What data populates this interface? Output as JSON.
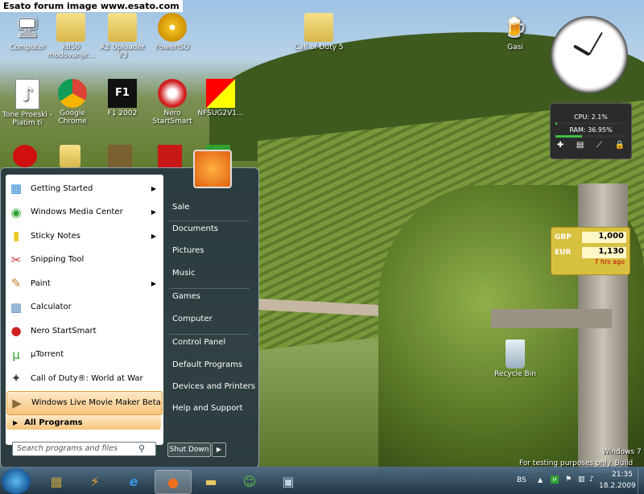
{
  "watermark": "Esato forum image www.esato.com",
  "desktop_icons": [
    {
      "label": "Computer",
      "icon": "computer-icon"
    },
    {
      "label": "k850 modovanje...",
      "icon": "folder-icon"
    },
    {
      "label": "A2 Uploader V3",
      "icon": "folder-icon"
    },
    {
      "label": "PowerISO",
      "icon": "disc-icon"
    },
    {
      "label": "Call of Duty 5",
      "icon": "folder-icon"
    },
    {
      "label": "Gasi",
      "icon": "beer-icon"
    },
    {
      "label": "Tone Proeski - Platim ti",
      "icon": "document-icon"
    },
    {
      "label": "Google Chrome",
      "icon": "chrome-icon"
    },
    {
      "label": "F1 2002",
      "icon": "f1-icon"
    },
    {
      "label": "Nero StartSmart",
      "icon": "nero-icon"
    },
    {
      "label": "NFSUG2V1...",
      "icon": "nfs-icon"
    },
    {
      "label": "Recycle Bin",
      "icon": "recycle-bin-icon"
    }
  ],
  "cpu_gadget": {
    "cpu": "CPU: 2.1%",
    "ram": "RAM: 36.95%",
    "cpu_frac": 0.021,
    "ram_frac": 0.3695
  },
  "currency_gadget": {
    "rows": [
      {
        "code": "GBP",
        "value": "1,000"
      },
      {
        "code": "EUR",
        "value": "1,130"
      }
    ],
    "status": "7 hrs ago"
  },
  "start_menu": {
    "programs": [
      {
        "label": "Getting Started",
        "icon": "getting-started-icon",
        "arrow": true
      },
      {
        "label": "Windows Media Center",
        "icon": "media-center-icon",
        "arrow": true
      },
      {
        "label": "Sticky Notes",
        "icon": "sticky-notes-icon",
        "arrow": true
      },
      {
        "label": "Snipping Tool",
        "icon": "scissors-icon",
        "arrow": false
      },
      {
        "label": "Paint",
        "icon": "paint-icon",
        "arrow": true
      },
      {
        "label": "Calculator",
        "icon": "calculator-icon",
        "arrow": false
      },
      {
        "label": "Nero StartSmart",
        "icon": "nero-icon",
        "arrow": false
      },
      {
        "label": "µTorrent",
        "icon": "utorrent-icon",
        "arrow": false
      },
      {
        "label": "Call of Duty®: World at War",
        "icon": "cod-icon",
        "arrow": false
      },
      {
        "label": "Windows Live Movie Maker Beta",
        "icon": "movie-maker-icon",
        "arrow": false
      }
    ],
    "all_programs": "All Programs",
    "search_placeholder": "Search programs and files",
    "right_items": [
      "Sale",
      "Documents",
      "Pictures",
      "Music",
      "Games",
      "Computer",
      "Control Panel",
      "Default Programs",
      "Devices and Printers",
      "Help and Support"
    ],
    "shutdown": "Shut Down"
  },
  "taskbar": {
    "apps": [
      "winrar-icon",
      "winamp-icon",
      "internet-explorer-icon",
      "firefox-icon",
      "explorer-icon",
      "messenger-icon",
      "remote-icon"
    ],
    "lang": "BS",
    "time": "21:35",
    "date": "18.2.2009"
  },
  "os_watermark": {
    "line1": "Windows 7",
    "line2": "For testing purposes only. Build 7000"
  }
}
